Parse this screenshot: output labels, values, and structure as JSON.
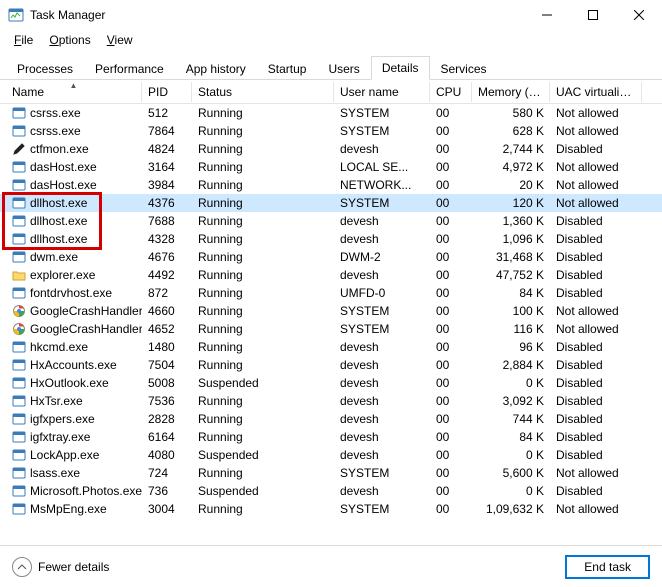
{
  "window": {
    "title": "Task Manager"
  },
  "menu": {
    "file": "File",
    "options": "Options",
    "view": "View"
  },
  "tabs": [
    {
      "label": "Processes"
    },
    {
      "label": "Performance"
    },
    {
      "label": "App history"
    },
    {
      "label": "Startup"
    },
    {
      "label": "Users"
    },
    {
      "label": "Details"
    },
    {
      "label": "Services"
    }
  ],
  "activeTab": 5,
  "columns": {
    "name": "Name",
    "pid": "PID",
    "status": "Status",
    "user": "User name",
    "cpu": "CPU",
    "mem": "Memory (a...",
    "uac": "UAC virtualizat..."
  },
  "processes": [
    {
      "icon": "app",
      "name": "csrss.exe",
      "pid": "512",
      "status": "Running",
      "user": "SYSTEM",
      "cpu": "00",
      "mem": "580 K",
      "uac": "Not allowed"
    },
    {
      "icon": "app",
      "name": "csrss.exe",
      "pid": "7864",
      "status": "Running",
      "user": "SYSTEM",
      "cpu": "00",
      "mem": "628 K",
      "uac": "Not allowed"
    },
    {
      "icon": "pen",
      "name": "ctfmon.exe",
      "pid": "4824",
      "status": "Running",
      "user": "devesh",
      "cpu": "00",
      "mem": "2,744 K",
      "uac": "Disabled"
    },
    {
      "icon": "app",
      "name": "dasHost.exe",
      "pid": "3164",
      "status": "Running",
      "user": "LOCAL SE...",
      "cpu": "00",
      "mem": "4,972 K",
      "uac": "Not allowed"
    },
    {
      "icon": "app",
      "name": "dasHost.exe",
      "pid": "3984",
      "status": "Running",
      "user": "NETWORK...",
      "cpu": "00",
      "mem": "20 K",
      "uac": "Not allowed"
    },
    {
      "icon": "app",
      "name": "dllhost.exe",
      "pid": "4376",
      "status": "Running",
      "user": "SYSTEM",
      "cpu": "00",
      "mem": "120 K",
      "uac": "Not allowed",
      "selected": true
    },
    {
      "icon": "app",
      "name": "dllhost.exe",
      "pid": "7688",
      "status": "Running",
      "user": "devesh",
      "cpu": "00",
      "mem": "1,360 K",
      "uac": "Disabled"
    },
    {
      "icon": "app",
      "name": "dllhost.exe",
      "pid": "4328",
      "status": "Running",
      "user": "devesh",
      "cpu": "00",
      "mem": "1,096 K",
      "uac": "Disabled"
    },
    {
      "icon": "app",
      "name": "dwm.exe",
      "pid": "4676",
      "status": "Running",
      "user": "DWM-2",
      "cpu": "00",
      "mem": "31,468 K",
      "uac": "Disabled"
    },
    {
      "icon": "folder",
      "name": "explorer.exe",
      "pid": "4492",
      "status": "Running",
      "user": "devesh",
      "cpu": "00",
      "mem": "47,752 K",
      "uac": "Disabled"
    },
    {
      "icon": "app",
      "name": "fontdrvhost.exe",
      "pid": "872",
      "status": "Running",
      "user": "UMFD-0",
      "cpu": "00",
      "mem": "84 K",
      "uac": "Disabled"
    },
    {
      "icon": "google",
      "name": "GoogleCrashHandler...",
      "pid": "4660",
      "status": "Running",
      "user": "SYSTEM",
      "cpu": "00",
      "mem": "100 K",
      "uac": "Not allowed"
    },
    {
      "icon": "google",
      "name": "GoogleCrashHandler...",
      "pid": "4652",
      "status": "Running",
      "user": "SYSTEM",
      "cpu": "00",
      "mem": "116 K",
      "uac": "Not allowed"
    },
    {
      "icon": "app",
      "name": "hkcmd.exe",
      "pid": "1480",
      "status": "Running",
      "user": "devesh",
      "cpu": "00",
      "mem": "96 K",
      "uac": "Disabled"
    },
    {
      "icon": "app",
      "name": "HxAccounts.exe",
      "pid": "7504",
      "status": "Running",
      "user": "devesh",
      "cpu": "00",
      "mem": "2,884 K",
      "uac": "Disabled"
    },
    {
      "icon": "app",
      "name": "HxOutlook.exe",
      "pid": "5008",
      "status": "Suspended",
      "user": "devesh",
      "cpu": "00",
      "mem": "0 K",
      "uac": "Disabled"
    },
    {
      "icon": "app",
      "name": "HxTsr.exe",
      "pid": "7536",
      "status": "Running",
      "user": "devesh",
      "cpu": "00",
      "mem": "3,092 K",
      "uac": "Disabled"
    },
    {
      "icon": "app",
      "name": "igfxpers.exe",
      "pid": "2828",
      "status": "Running",
      "user": "devesh",
      "cpu": "00",
      "mem": "744 K",
      "uac": "Disabled"
    },
    {
      "icon": "app",
      "name": "igfxtray.exe",
      "pid": "6164",
      "status": "Running",
      "user": "devesh",
      "cpu": "00",
      "mem": "84 K",
      "uac": "Disabled"
    },
    {
      "icon": "app",
      "name": "LockApp.exe",
      "pid": "4080",
      "status": "Suspended",
      "user": "devesh",
      "cpu": "00",
      "mem": "0 K",
      "uac": "Disabled"
    },
    {
      "icon": "app",
      "name": "lsass.exe",
      "pid": "724",
      "status": "Running",
      "user": "SYSTEM",
      "cpu": "00",
      "mem": "5,600 K",
      "uac": "Not allowed"
    },
    {
      "icon": "app",
      "name": "Microsoft.Photos.exe",
      "pid": "736",
      "status": "Suspended",
      "user": "devesh",
      "cpu": "00",
      "mem": "0 K",
      "uac": "Disabled"
    },
    {
      "icon": "app",
      "name": "MsMpEng.exe",
      "pid": "3004",
      "status": "Running",
      "user": "SYSTEM",
      "cpu": "00",
      "mem": "1,09,632 K",
      "uac": "Not allowed"
    }
  ],
  "footer": {
    "fewer": "Fewer details",
    "endtask": "End task"
  }
}
